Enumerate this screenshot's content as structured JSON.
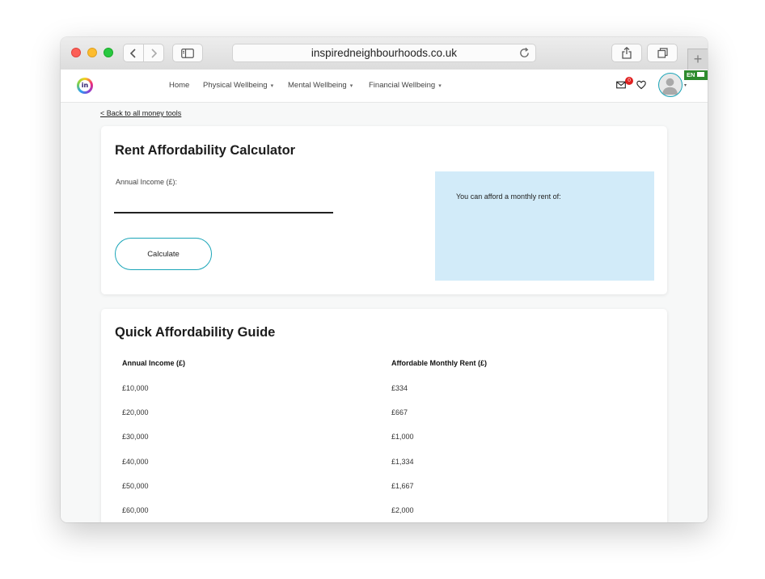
{
  "browser": {
    "url": "inspiredneighbourhoods.co.uk",
    "new_tab": "+"
  },
  "header": {
    "logo_text": "in",
    "nav": [
      {
        "label": "Home",
        "has_caret": false
      },
      {
        "label": "Physical Wellbeing",
        "has_caret": true
      },
      {
        "label": "Mental Wellbeing",
        "has_caret": true
      },
      {
        "label": "Financial Wellbeing",
        "has_caret": true
      }
    ],
    "caret_glyph": "▾",
    "notification_count": "0",
    "language": "EN"
  },
  "page": {
    "back_link": "< Back to all money tools"
  },
  "calculator": {
    "title": "Rent Affordability Calculator",
    "income_label": "Annual Income (£):",
    "income_value": "",
    "button_label": "Calculate",
    "result_label": "You can afford a monthly rent of:"
  },
  "guide": {
    "title": "Quick Affordability Guide",
    "columns": [
      "Annual Income (£)",
      "Affordable Monthly Rent (£)"
    ],
    "rows": [
      [
        "£10,000",
        "£334"
      ],
      [
        "£20,000",
        "£667"
      ],
      [
        "£30,000",
        "£1,000"
      ],
      [
        "£40,000",
        "£1,334"
      ],
      [
        "£50,000",
        "£1,667"
      ],
      [
        "£60,000",
        "£2,000"
      ]
    ]
  },
  "colors": {
    "accent": "#1aa5b8",
    "result_bg": "#d2ebf9",
    "badge": "#e02020",
    "lang_badge": "#2e8b2e"
  }
}
